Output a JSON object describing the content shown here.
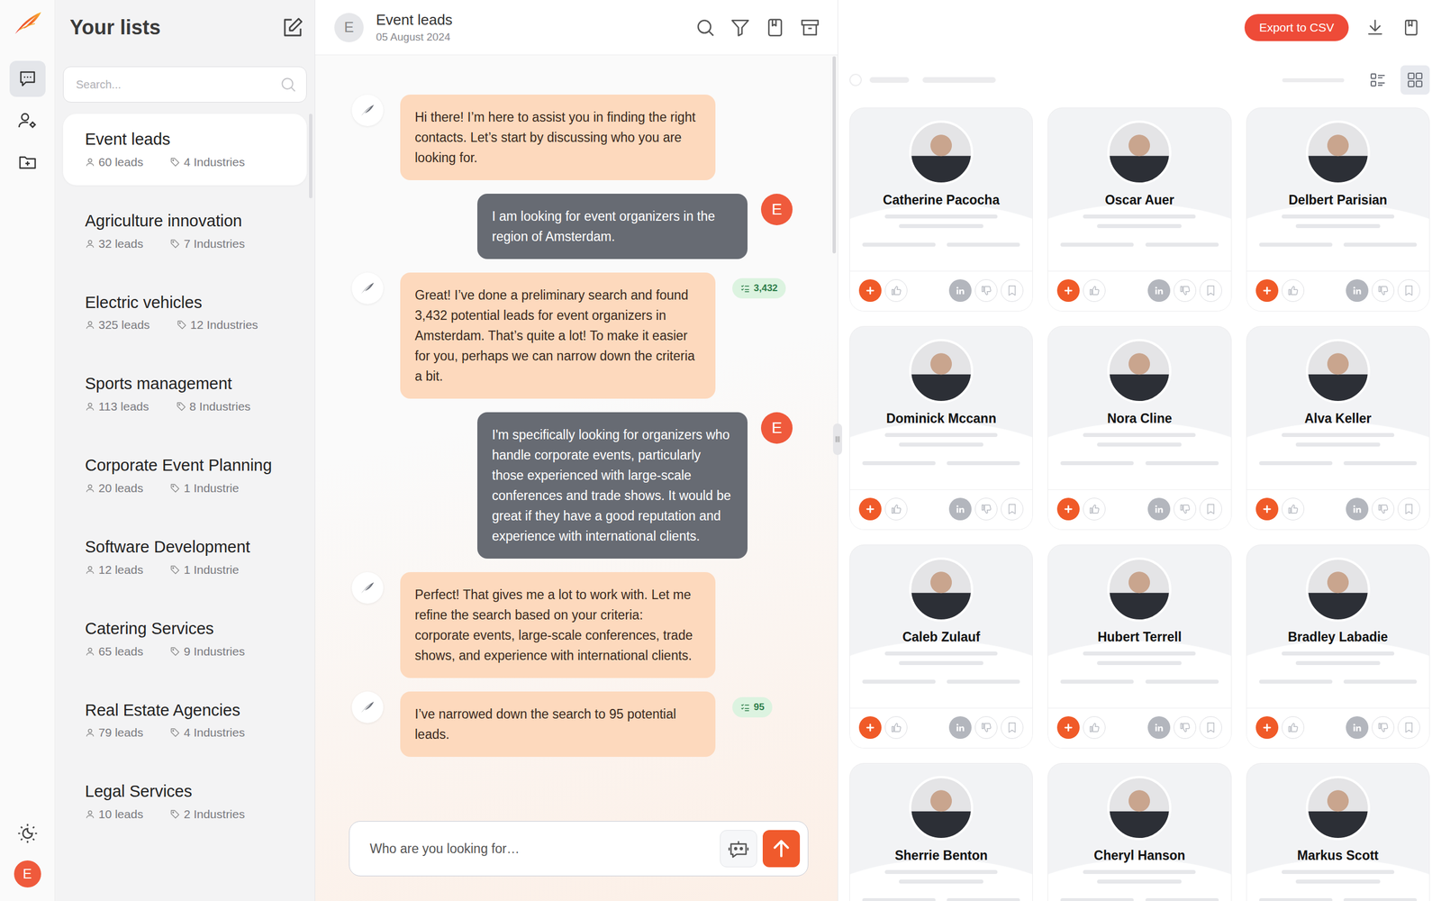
{
  "app": {
    "user_initial": "E"
  },
  "rail": {
    "items": [
      {
        "kind": "chat",
        "selected": true
      },
      {
        "kind": "contacts",
        "selected": false
      },
      {
        "kind": "folder",
        "selected": false
      }
    ]
  },
  "lists_panel": {
    "title": "Your lists",
    "search": {
      "placeholder": "Search..."
    },
    "items": [
      {
        "name": "Event leads",
        "leads": "60 leads",
        "industries": "4 Industries",
        "selected": true
      },
      {
        "name": "Agriculture innovation",
        "leads": "32 leads",
        "industries": "7 Industries",
        "selected": false
      },
      {
        "name": "Electric vehicles",
        "leads": "325 leads",
        "industries": "12 Industries",
        "selected": false
      },
      {
        "name": "Sports management",
        "leads": "113 leads",
        "industries": "8 Industries",
        "selected": false
      },
      {
        "name": "Corporate Event Planning",
        "leads": "20 leads",
        "industries": "1 Industrie",
        "selected": false
      },
      {
        "name": "Software Development",
        "leads": "12 leads",
        "industries": "1 Industrie",
        "selected": false
      },
      {
        "name": "Catering Services",
        "leads": "65 leads",
        "industries": "9 Industries",
        "selected": false
      },
      {
        "name": "Real Estate Agencies",
        "leads": "79 leads",
        "industries": "4 Industries",
        "selected": false
      },
      {
        "name": "Legal Services",
        "leads": "10 leads",
        "industries": "2 Industries",
        "selected": false
      }
    ]
  },
  "chat": {
    "avatar": "E",
    "title": "Event leads",
    "date": "05 August 2024",
    "messages": [
      {
        "role": "bot",
        "text": "Hi there! I’m here to assist you in finding the right contacts. Let’s start by discussing who you are looking for."
      },
      {
        "role": "user",
        "avatar": "E",
        "text": "I am looking for event organizers in the region of Amsterdam."
      },
      {
        "role": "bot",
        "badge": "3,432",
        "text": "Great! I’ve done a preliminary search and found 3,432 potential leads for event organizers in Amsterdam. That’s quite a lot! To make it easier for you, perhaps we can narrow down the criteria a bit."
      },
      {
        "role": "user",
        "avatar": "E",
        "text": "I'm specifically looking for organizers who handle corporate events, particularly those experienced with large-scale conferences and trade shows. It would be great if they have a good reputation and experience with international clients."
      },
      {
        "role": "bot",
        "text": "Perfect! That gives me a lot to work with. Let me refine the search based on your criteria: corporate events, large-scale conferences, trade shows, and experience with international clients."
      },
      {
        "role": "bot",
        "badge": "95",
        "text": "I’ve narrowed down the search to 95 potential leads."
      }
    ],
    "input": {
      "placeholder": "Who are you looking for…"
    }
  },
  "results": {
    "export_button": "Export to CSV",
    "views": [
      {
        "kind": "list",
        "selected": false
      },
      {
        "kind": "grid",
        "selected": true
      }
    ],
    "cards": [
      {
        "name": "Catherine Pacocha"
      },
      {
        "name": "Oscar Auer"
      },
      {
        "name": "Delbert Parisian"
      },
      {
        "name": "Dominick Mccann"
      },
      {
        "name": "Nora Cline"
      },
      {
        "name": "Alva Keller"
      },
      {
        "name": "Caleb Zulauf"
      },
      {
        "name": "Hubert Terrell"
      },
      {
        "name": "Bradley Labadie"
      },
      {
        "name": "Sherrie Benton"
      },
      {
        "name": "Cheryl Hanson"
      },
      {
        "name": "Markus Scott"
      }
    ]
  }
}
